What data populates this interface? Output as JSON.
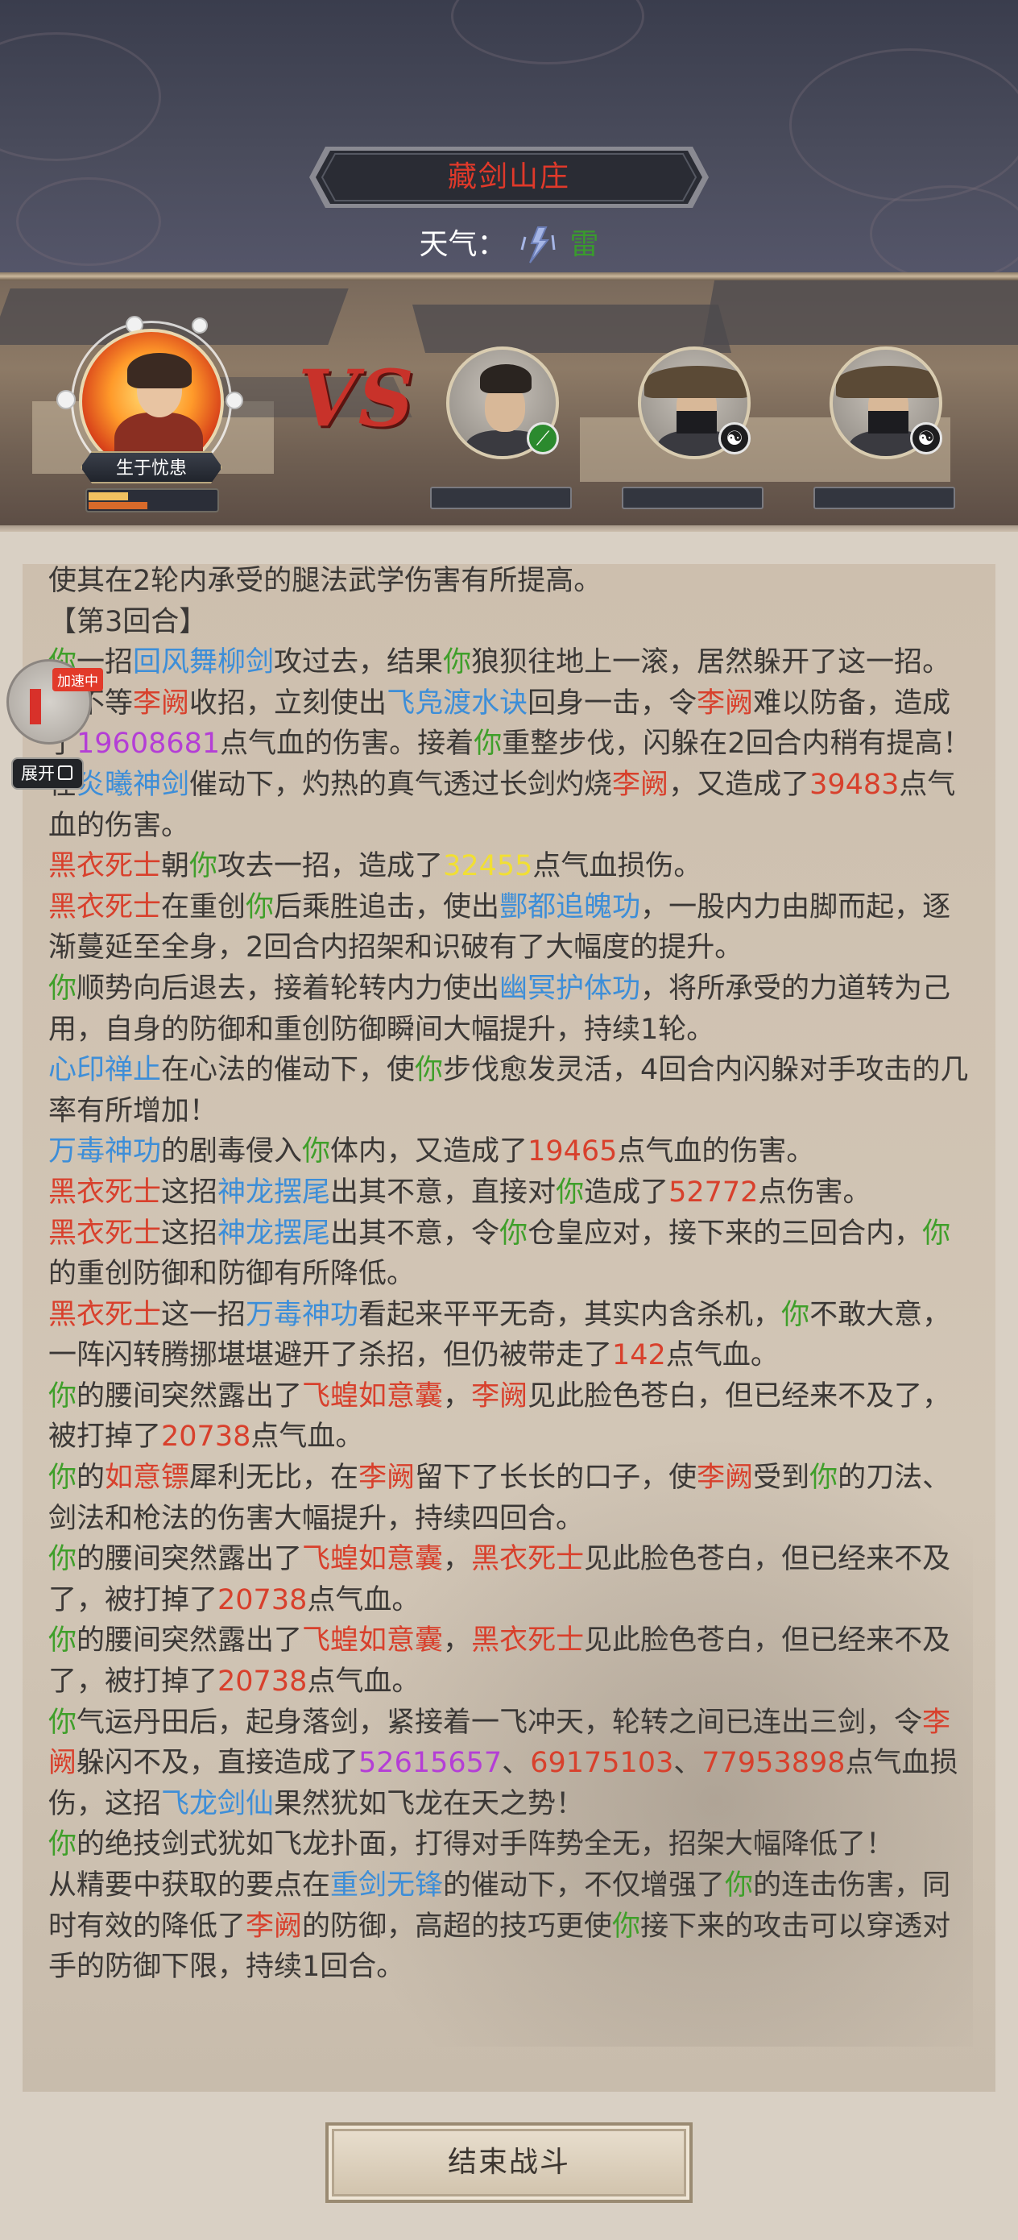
{
  "location": {
    "name": "藏剑山庄"
  },
  "weather": {
    "label": "天气：",
    "value": "雷",
    "icon": "lightning-icon"
  },
  "player": {
    "name": "生于忧患",
    "hp_fraction": 0.3,
    "mp_fraction": 0.45
  },
  "vs_label": "VS",
  "enemies": [
    {
      "badge_icon": "sword-skill-icon",
      "badge_color": "#2b8a2e"
    },
    {
      "badge_icon": "yin-yang-icon",
      "badge_color": "#1d1d1f"
    },
    {
      "badge_icon": "yin-yang-icon",
      "badge_color": "#1d1d1f"
    }
  ],
  "speed_widget": {
    "tag": "加速中"
  },
  "expand_label": "展开",
  "log": [
    [
      [
        "n",
        "使其在2轮内承受的腿法武学伤害有所提高。"
      ]
    ],
    [
      [
        "n",
        "【第3回合】"
      ]
    ],
    [
      [
        "g",
        "你"
      ],
      [
        "n",
        "一招"
      ],
      [
        "b",
        "回风舞柳剑"
      ],
      [
        "n",
        "攻过去，结果"
      ],
      [
        "g",
        "你"
      ],
      [
        "n",
        "狼狈往地上一滚，居然躲开了这一招。"
      ]
    ],
    [
      [
        "g",
        "你"
      ],
      [
        "n",
        "不等"
      ],
      [
        "r",
        "李阙"
      ],
      [
        "n",
        "收招，立刻使出"
      ],
      [
        "b",
        "飞凫渡水诀"
      ],
      [
        "n",
        "回身一击，令"
      ],
      [
        "r",
        "李阙"
      ],
      [
        "n",
        "难以防备，造成了"
      ],
      [
        "p",
        "19608681"
      ],
      [
        "n",
        "点气血的伤害。接着"
      ],
      [
        "g",
        "你"
      ],
      [
        "n",
        "重整步伐，闪躲在2回合内稍有提高！"
      ]
    ],
    [
      [
        "n",
        "在"
      ],
      [
        "b",
        "炎曦神剑"
      ],
      [
        "n",
        "催动下，灼热的真气透过长剑灼烧"
      ],
      [
        "r",
        "李阙"
      ],
      [
        "n",
        "，又造成了"
      ],
      [
        "r",
        "39483"
      ],
      [
        "n",
        "点气血的伤害。"
      ]
    ],
    [
      [
        "r",
        "黑衣死士"
      ],
      [
        "n",
        "朝"
      ],
      [
        "g",
        "你"
      ],
      [
        "n",
        "攻去一招，造成了"
      ],
      [
        "y",
        "32455"
      ],
      [
        "n",
        "点气血损伤。"
      ]
    ],
    [
      [
        "r",
        "黑衣死士"
      ],
      [
        "n",
        "在重创"
      ],
      [
        "g",
        "你"
      ],
      [
        "n",
        "后乘胜追击，使出"
      ],
      [
        "b",
        "酆都追魄功"
      ],
      [
        "n",
        "，一股内力由脚而起，逐渐蔓延至全身，2回合内招架和识破有了大幅度的提升。"
      ]
    ],
    [
      [
        "g",
        "你"
      ],
      [
        "n",
        "顺势向后退去，接着轮转内力使出"
      ],
      [
        "b",
        "幽冥护体功"
      ],
      [
        "n",
        "，将所承受的力道转为己用，自身的防御和重创防御瞬间大幅提升，持续1轮。"
      ]
    ],
    [
      [
        "b",
        "心印禅止"
      ],
      [
        "n",
        "在心法的催动下，使"
      ],
      [
        "g",
        "你"
      ],
      [
        "n",
        "步伐愈发灵活，4回合内闪躲对手攻击的几率有所增加！"
      ]
    ],
    [
      [
        "b",
        "万毒神功"
      ],
      [
        "n",
        "的剧毒侵入"
      ],
      [
        "g",
        "你"
      ],
      [
        "n",
        "体内，又造成了"
      ],
      [
        "r",
        "19465"
      ],
      [
        "n",
        "点气血的伤害。"
      ]
    ],
    [
      [
        "r",
        "黑衣死士"
      ],
      [
        "n",
        "这招"
      ],
      [
        "b",
        "神龙摆尾"
      ],
      [
        "n",
        "出其不意，直接对"
      ],
      [
        "g",
        "你"
      ],
      [
        "n",
        "造成了"
      ],
      [
        "r",
        "52772"
      ],
      [
        "n",
        "点伤害。"
      ]
    ],
    [
      [
        "r",
        "黑衣死士"
      ],
      [
        "n",
        "这招"
      ],
      [
        "b",
        "神龙摆尾"
      ],
      [
        "n",
        "出其不意，令"
      ],
      [
        "g",
        "你"
      ],
      [
        "n",
        "仓皇应对，接下来的三回合内，"
      ],
      [
        "g",
        "你"
      ],
      [
        "n",
        "的重创防御和防御有所降低。"
      ]
    ],
    [
      [
        "r",
        "黑衣死士"
      ],
      [
        "n",
        "这一招"
      ],
      [
        "b",
        "万毒神功"
      ],
      [
        "n",
        "看起来平平无奇，其实内含杀机，"
      ],
      [
        "g",
        "你"
      ],
      [
        "n",
        "不敢大意，一阵闪转腾挪堪堪避开了杀招，但仍被带走了"
      ],
      [
        "r",
        "142"
      ],
      [
        "n",
        "点气血。"
      ]
    ],
    [
      [
        "g",
        "你"
      ],
      [
        "n",
        "的腰间突然露出了"
      ],
      [
        "r",
        "飞蝗如意囊"
      ],
      [
        "n",
        "，"
      ],
      [
        "r",
        "李阙"
      ],
      [
        "n",
        "见此脸色苍白，但已经来不及了，被打掉了"
      ],
      [
        "r",
        "20738"
      ],
      [
        "n",
        "点气血。"
      ]
    ],
    [
      [
        "g",
        "你"
      ],
      [
        "n",
        "的"
      ],
      [
        "r",
        "如意镖"
      ],
      [
        "n",
        "犀利无比，在"
      ],
      [
        "r",
        "李阙"
      ],
      [
        "n",
        "留下了长长的口子，使"
      ],
      [
        "r",
        "李阙"
      ],
      [
        "n",
        "受到"
      ],
      [
        "g",
        "你"
      ],
      [
        "n",
        "的刀法、剑法和枪法的伤害大幅提升，持续四回合。"
      ]
    ],
    [
      [
        "g",
        "你"
      ],
      [
        "n",
        "的腰间突然露出了"
      ],
      [
        "r",
        "飞蝗如意囊"
      ],
      [
        "n",
        "，"
      ],
      [
        "r",
        "黑衣死士"
      ],
      [
        "n",
        "见此脸色苍白，但已经来不及了，被打掉了"
      ],
      [
        "r",
        "20738"
      ],
      [
        "n",
        "点气血。"
      ]
    ],
    [
      [
        "g",
        "你"
      ],
      [
        "n",
        "的腰间突然露出了"
      ],
      [
        "r",
        "飞蝗如意囊"
      ],
      [
        "n",
        "，"
      ],
      [
        "r",
        "黑衣死士"
      ],
      [
        "n",
        "见此脸色苍白，但已经来不及了，被打掉了"
      ],
      [
        "r",
        "20738"
      ],
      [
        "n",
        "点气血。"
      ]
    ],
    [
      [
        "g",
        "你"
      ],
      [
        "n",
        "气运丹田后，起身落剑，紧接着一飞冲天，轮转之间已连出三剑，令"
      ],
      [
        "r",
        "李阙"
      ],
      [
        "n",
        "躲闪不及，直接造成了"
      ],
      [
        "p",
        "52615657"
      ],
      [
        "n",
        "、"
      ],
      [
        "r",
        "69175103"
      ],
      [
        "n",
        "、"
      ],
      [
        "r",
        "77953898"
      ],
      [
        "n",
        "点气血损伤，这招"
      ],
      [
        "b",
        "飞龙剑仙"
      ],
      [
        "n",
        "果然犹如飞龙在天之势！"
      ]
    ],
    [
      [
        "g",
        "你"
      ],
      [
        "n",
        "的绝技剑式犹如飞龙扑面，打得对手阵势全无，招架大幅降低了！"
      ]
    ],
    [
      [
        "n",
        "从精要中获取的要点在"
      ],
      [
        "b",
        "重剑无锋"
      ],
      [
        "n",
        "的催动下，不仅增强了"
      ],
      [
        "g",
        "你"
      ],
      [
        "n",
        "的连击伤害，同时有效的降低了"
      ],
      [
        "r",
        "李阙"
      ],
      [
        "n",
        "的防御，高超的技巧更使"
      ],
      [
        "g",
        "你"
      ],
      [
        "n",
        "接下来的攻击可以穿透对手的防御下限，持续1回合。"
      ]
    ]
  ],
  "end_button": {
    "label": "结束战斗"
  }
}
